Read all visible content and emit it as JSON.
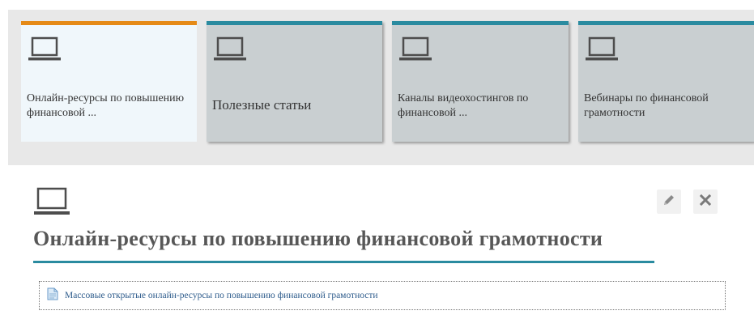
{
  "tiles": [
    {
      "label": "Онлайн-ресурсы по повышению финансовой ...",
      "active": true,
      "icon": "laptop-icon"
    },
    {
      "label": "Полезные статьи",
      "active": false,
      "icon": "laptop-icon"
    },
    {
      "label": "Каналы видеохостингов по финансовой ...",
      "active": false,
      "icon": "laptop-icon"
    },
    {
      "label": "Вебинары по финансовой грамотности",
      "active": false,
      "icon": "laptop-icon"
    }
  ],
  "content": {
    "icon": "laptop-icon",
    "title": "Онлайн-ресурсы по повышению финансовой грамотности",
    "actions": {
      "edit_icon": "pencil-icon",
      "close_icon": "close-icon"
    },
    "resource": {
      "icon": "document-icon",
      "link_text": "Массовые открытые онлайн-ресурсы по повышению финансовой грамотности"
    }
  },
  "colors": {
    "accent_teal": "#2a8ba0",
    "active_orange": "#e58a17",
    "tile_bg": "#c9cfd1",
    "active_tile_bg": "#f0f7fb"
  }
}
